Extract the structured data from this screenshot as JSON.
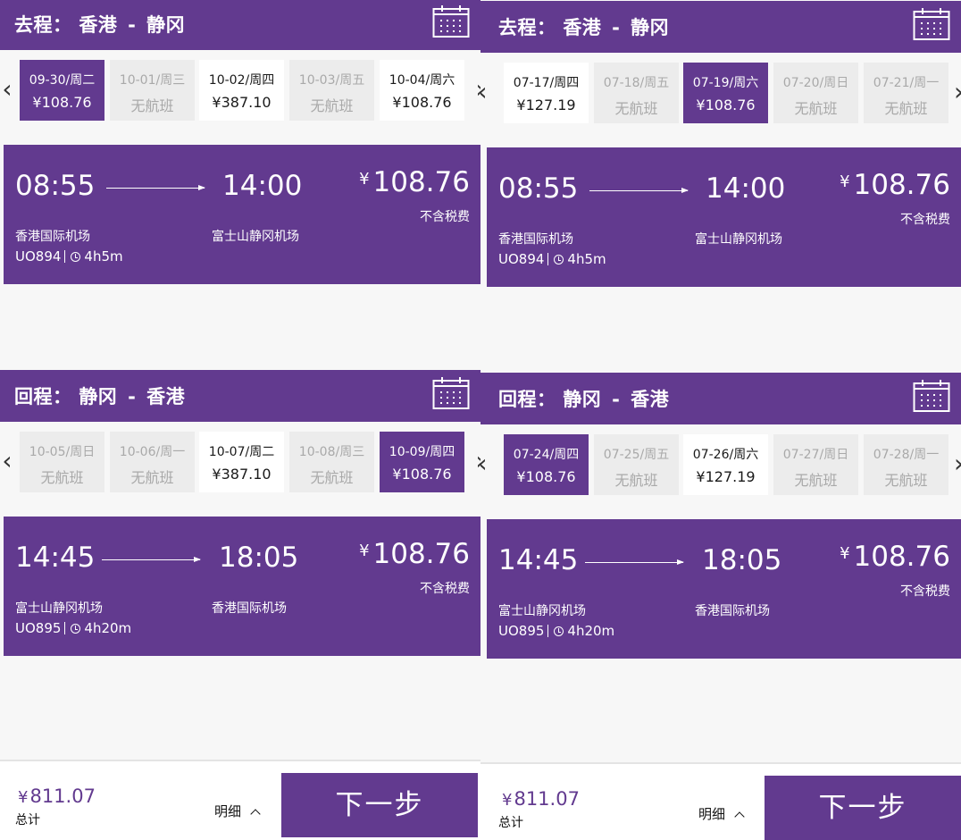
{
  "colors": {
    "brand": "#623a8f",
    "disabled_bg": "#ececec",
    "disabled_text": "#a9a9a9",
    "page_bg": "#f7f7f7"
  },
  "icons": {
    "calendar": "calendar-icon",
    "prev": "chevron-left-icon",
    "next": "chevron-right-icon",
    "clock": "clock-icon",
    "detail": "chevron-up-icon"
  },
  "panels": [
    {
      "outbound": {
        "label": "去程：",
        "origin": "香港",
        "sep": "-",
        "destination": "静冈",
        "dates": [
          {
            "date": "09-30/周二",
            "price": "¥108.76",
            "state": "selected"
          },
          {
            "date": "10-01/周三",
            "price": "无航班",
            "state": "none"
          },
          {
            "date": "10-02/周四",
            "price": "¥387.10",
            "state": "available"
          },
          {
            "date": "10-03/周五",
            "price": "无航班",
            "state": "none"
          },
          {
            "date": "10-04/周六",
            "price": "¥108.76",
            "state": "available"
          }
        ],
        "flight": {
          "dep_time": "08:55",
          "arr_time": "14:00",
          "cur": "¥",
          "price": "108.76",
          "tax_note": "不含税费",
          "dep_airport": "香港国际机场",
          "arr_airport": "富士山静冈机场",
          "flight_no": "UO894",
          "duration": "4h5m"
        }
      },
      "inbound": {
        "label": "回程：",
        "origin": "静冈",
        "sep": "-",
        "destination": "香港",
        "dates": [
          {
            "date": "10-05/周日",
            "price": "无航班",
            "state": "none"
          },
          {
            "date": "10-06/周一",
            "price": "无航班",
            "state": "none"
          },
          {
            "date": "10-07/周二",
            "price": "¥387.10",
            "state": "available"
          },
          {
            "date": "10-08/周三",
            "price": "无航班",
            "state": "none"
          },
          {
            "date": "10-09/周四",
            "price": "¥108.76",
            "state": "selected"
          }
        ],
        "flight": {
          "dep_time": "14:45",
          "arr_time": "18:05",
          "cur": "¥",
          "price": "108.76",
          "tax_note": "不含税费",
          "dep_airport": "富士山静冈机场",
          "arr_airport": "香港国际机场",
          "flight_no": "UO895",
          "duration": "4h20m"
        }
      },
      "footer": {
        "cur": "¥",
        "total": "811.07",
        "total_label": "总计",
        "detail_label": "明细",
        "next_label": "下一步"
      }
    },
    {
      "outbound": {
        "label": "去程：",
        "origin": "香港",
        "sep": "-",
        "destination": "静冈",
        "dates": [
          {
            "date": "07-17/周四",
            "price": "¥127.19",
            "state": "available"
          },
          {
            "date": "07-18/周五",
            "price": "无航班",
            "state": "none"
          },
          {
            "date": "07-19/周六",
            "price": "¥108.76",
            "state": "selected"
          },
          {
            "date": "07-20/周日",
            "price": "无航班",
            "state": "none"
          },
          {
            "date": "07-21/周一",
            "price": "无航班",
            "state": "none"
          }
        ],
        "flight": {
          "dep_time": "08:55",
          "arr_time": "14:00",
          "cur": "¥",
          "price": "108.76",
          "tax_note": "不含税费",
          "dep_airport": "香港国际机场",
          "arr_airport": "富士山静冈机场",
          "flight_no": "UO894",
          "duration": "4h5m"
        }
      },
      "inbound": {
        "label": "回程：",
        "origin": "静冈",
        "sep": "-",
        "destination": "香港",
        "dates": [
          {
            "date": "07-24/周四",
            "price": "¥108.76",
            "state": "selected"
          },
          {
            "date": "07-25/周五",
            "price": "无航班",
            "state": "none"
          },
          {
            "date": "07-26/周六",
            "price": "¥127.19",
            "state": "available"
          },
          {
            "date": "07-27/周日",
            "price": "无航班",
            "state": "none"
          },
          {
            "date": "07-28/周一",
            "price": "无航班",
            "state": "none"
          }
        ],
        "flight": {
          "dep_time": "14:45",
          "arr_time": "18:05",
          "cur": "¥",
          "price": "108.76",
          "tax_note": "不含税费",
          "dep_airport": "富士山静冈机场",
          "arr_airport": "香港国际机场",
          "flight_no": "UO895",
          "duration": "4h20m"
        }
      },
      "footer": {
        "cur": "¥",
        "total": "811.07",
        "total_label": "总计",
        "detail_label": "明细",
        "next_label": "下一步"
      }
    }
  ]
}
